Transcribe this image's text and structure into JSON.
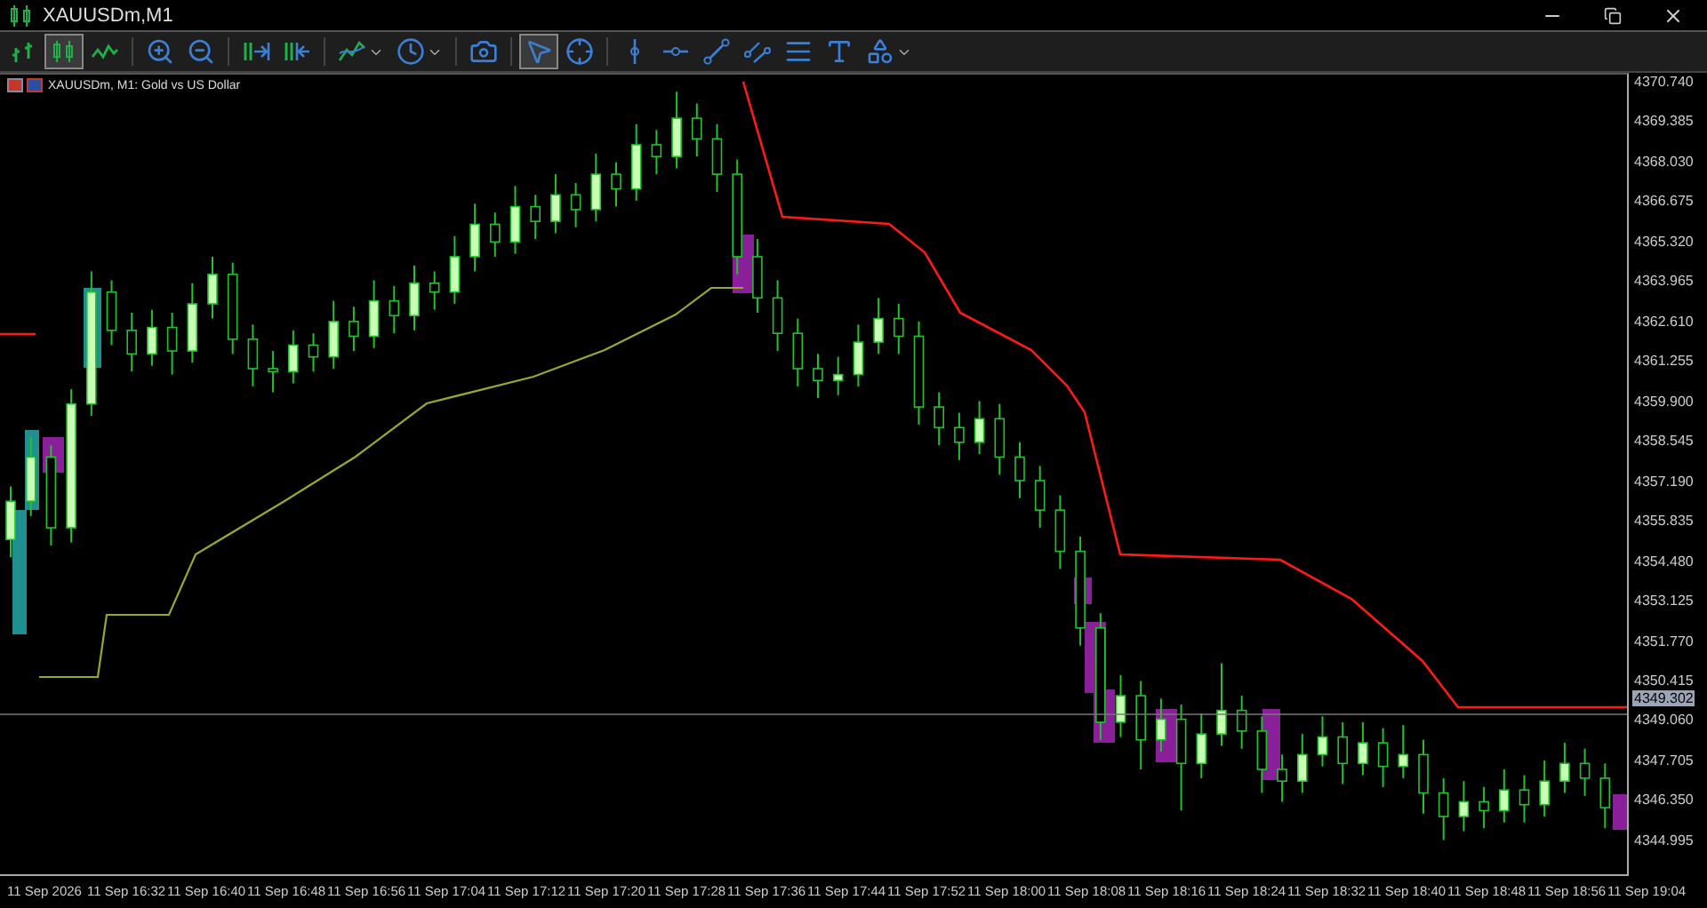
{
  "window": {
    "title": "XAUUSDm,M1"
  },
  "toolbar": [
    {
      "kind": "bars",
      "selected": false
    },
    {
      "kind": "candles",
      "selected": true
    },
    {
      "kind": "line",
      "selected": false
    },
    {
      "kind": "sep"
    },
    {
      "kind": "zoom-in",
      "selected": false
    },
    {
      "kind": "zoom-out",
      "selected": false
    },
    {
      "kind": "sep"
    },
    {
      "kind": "scroll",
      "selected": false
    },
    {
      "kind": "shift",
      "selected": false
    },
    {
      "kind": "sep"
    },
    {
      "kind": "indicators",
      "selected": false,
      "dropdown": true
    },
    {
      "kind": "clock",
      "selected": false,
      "dropdown": true
    },
    {
      "kind": "sep"
    },
    {
      "kind": "camera",
      "selected": false
    },
    {
      "kind": "sep"
    },
    {
      "kind": "cursor",
      "selected": true
    },
    {
      "kind": "crosshair",
      "selected": false
    },
    {
      "kind": "sep"
    },
    {
      "kind": "vline",
      "selected": false
    },
    {
      "kind": "hline",
      "selected": false
    },
    {
      "kind": "trend",
      "selected": false
    },
    {
      "kind": "channel",
      "selected": false
    },
    {
      "kind": "fibo",
      "selected": false
    },
    {
      "kind": "text",
      "selected": false
    },
    {
      "kind": "shapes",
      "selected": false,
      "dropdown": true
    }
  ],
  "chart": {
    "header": "XAUUSDm, M1:  Gold vs US Dollar",
    "current_price": "4349.302",
    "chart_data": {
      "type": "candlestick",
      "ylim": [
        4343.78,
        4370.98
      ],
      "yticks": [
        {
          "value": 4370.74,
          "label": "4370.740"
        },
        {
          "value": 4369.385,
          "label": "4369.385"
        },
        {
          "value": 4368.03,
          "label": "4368.030"
        },
        {
          "value": 4366.675,
          "label": "4366.675"
        },
        {
          "value": 4365.32,
          "label": "4365.320"
        },
        {
          "value": 4363.965,
          "label": "4363.965"
        },
        {
          "value": 4362.61,
          "label": "4362.610"
        },
        {
          "value": 4361.255,
          "label": "4361.255"
        },
        {
          "value": 4359.9,
          "label": "4359.900"
        },
        {
          "value": 4358.545,
          "label": "4358.545"
        },
        {
          "value": 4357.19,
          "label": "4357.190"
        },
        {
          "value": 4355.835,
          "label": "4355.835"
        },
        {
          "value": 4354.48,
          "label": "4354.480"
        },
        {
          "value": 4353.125,
          "label": "4353.125"
        },
        {
          "value": 4351.77,
          "label": "4351.770"
        },
        {
          "value": 4350.415,
          "label": "4350.415"
        },
        {
          "value": 4349.06,
          "label": "4349.060"
        },
        {
          "value": 4347.705,
          "label": "4347.705"
        },
        {
          "value": 4346.35,
          "label": "4346.350"
        },
        {
          "value": 4344.995,
          "label": "4344.995"
        }
      ],
      "categories": [
        null,
        null,
        null,
        null,
        null,
        null,
        null,
        null,
        null,
        null,
        null,
        null,
        null,
        null,
        null,
        null,
        null,
        null,
        null,
        null,
        null,
        null,
        null,
        null,
        null,
        null,
        null,
        null,
        null,
        null,
        null,
        null,
        null,
        null,
        null,
        null,
        null,
        null,
        null,
        null,
        null,
        null,
        null,
        null,
        null,
        null,
        null,
        null,
        null,
        null,
        null,
        null,
        null,
        null,
        null,
        null,
        null,
        null,
        null,
        null,
        null,
        null,
        null,
        null,
        null,
        null,
        null,
        null,
        null,
        null,
        null,
        null,
        null,
        null,
        null,
        null,
        null,
        null,
        null,
        null
      ],
      "ohlc": [
        [
          4355.2,
          4357.0,
          4354.6,
          4356.5
        ],
        [
          4356.5,
          4358.7,
          4356.0,
          4358.0
        ],
        [
          4358.0,
          4358.4,
          4355.0,
          4355.6
        ],
        [
          4355.6,
          4360.3,
          4355.1,
          4359.8
        ],
        [
          4359.8,
          4364.3,
          4359.4,
          4363.6
        ],
        [
          4363.6,
          4364.0,
          4361.8,
          4362.3
        ],
        [
          4362.3,
          4362.9,
          4360.9,
          4361.5
        ],
        [
          4361.5,
          4363.0,
          4361.1,
          4362.4
        ],
        [
          4362.4,
          4362.9,
          4360.8,
          4361.6
        ],
        [
          4361.6,
          4363.9,
          4361.2,
          4363.2
        ],
        [
          4363.2,
          4364.8,
          4362.7,
          4364.2
        ],
        [
          4364.2,
          4364.6,
          4361.5,
          4362.0
        ],
        [
          4362.0,
          4362.5,
          4360.4,
          4361.0
        ],
        [
          4361.0,
          4361.6,
          4360.2,
          4360.9
        ],
        [
          4360.9,
          4362.3,
          4360.5,
          4361.8
        ],
        [
          4361.8,
          4362.2,
          4360.9,
          4361.4
        ],
        [
          4361.4,
          4363.3,
          4361.0,
          4362.6
        ],
        [
          4362.6,
          4363.1,
          4361.6,
          4362.1
        ],
        [
          4362.1,
          4364.0,
          4361.7,
          4363.3
        ],
        [
          4363.3,
          4363.8,
          4362.2,
          4362.8
        ],
        [
          4362.8,
          4364.5,
          4362.3,
          4363.9
        ],
        [
          4363.9,
          4364.3,
          4363.0,
          4363.6
        ],
        [
          4363.6,
          4365.5,
          4363.2,
          4364.8
        ],
        [
          4364.8,
          4366.6,
          4364.3,
          4365.9
        ],
        [
          4365.9,
          4366.3,
          4364.8,
          4365.3
        ],
        [
          4365.3,
          4367.2,
          4364.9,
          4366.5
        ],
        [
          4366.5,
          4366.9,
          4365.4,
          4366.0
        ],
        [
          4366.0,
          4367.6,
          4365.6,
          4366.9
        ],
        [
          4366.9,
          4367.3,
          4365.8,
          4366.4
        ],
        [
          4366.4,
          4368.3,
          4366.0,
          4367.6
        ],
        [
          4367.6,
          4368.0,
          4366.5,
          4367.1
        ],
        [
          4367.1,
          4369.3,
          4366.7,
          4368.6
        ],
        [
          4368.6,
          4369.1,
          4367.6,
          4368.2
        ],
        [
          4368.2,
          4370.4,
          4367.8,
          4369.5
        ],
        [
          4369.5,
          4370.0,
          4368.2,
          4368.8
        ],
        [
          4368.8,
          4369.3,
          4367.0,
          4367.6
        ],
        [
          4367.6,
          4368.1,
          4364.2,
          4364.8
        ],
        [
          4364.8,
          4365.4,
          4362.9,
          4363.4
        ],
        [
          4363.4,
          4364.0,
          4361.6,
          4362.2
        ],
        [
          4362.2,
          4362.7,
          4360.4,
          4361.0
        ],
        [
          4361.0,
          4361.5,
          4360.0,
          4360.6
        ],
        [
          4360.6,
          4361.4,
          4360.1,
          4360.8
        ],
        [
          4360.8,
          4362.5,
          4360.4,
          4361.9
        ],
        [
          4361.9,
          4363.4,
          4361.5,
          4362.7
        ],
        [
          4362.7,
          4363.2,
          4361.5,
          4362.1
        ],
        [
          4362.1,
          4362.6,
          4359.1,
          4359.7
        ],
        [
          4359.7,
          4360.2,
          4358.4,
          4359.0
        ],
        [
          4359.0,
          4359.5,
          4357.9,
          4358.5
        ],
        [
          4358.5,
          4359.9,
          4358.1,
          4359.3
        ],
        [
          4359.3,
          4359.8,
          4357.4,
          4358.0
        ],
        [
          4358.0,
          4358.5,
          4356.6,
          4357.2
        ],
        [
          4357.2,
          4357.7,
          4355.6,
          4356.2
        ],
        [
          4356.2,
          4356.7,
          4354.2,
          4354.8
        ],
        [
          4354.8,
          4355.3,
          4351.6,
          4352.2
        ],
        [
          4352.2,
          4352.7,
          4348.4,
          4349.0
        ],
        [
          4349.0,
          4350.6,
          4348.5,
          4349.9
        ],
        [
          4349.9,
          4350.4,
          4347.4,
          4348.4
        ],
        [
          4348.4,
          4349.8,
          4348.0,
          4349.1
        ],
        [
          4349.1,
          4349.6,
          4346.0,
          4347.6
        ],
        [
          4347.6,
          4349.3,
          4347.1,
          4348.6
        ],
        [
          4348.6,
          4351.0,
          4348.2,
          4349.4
        ],
        [
          4349.4,
          4349.9,
          4348.1,
          4348.7
        ],
        [
          4348.7,
          4349.2,
          4346.6,
          4347.4
        ],
        [
          4347.4,
          4347.9,
          4346.3,
          4347.0
        ],
        [
          4347.0,
          4348.6,
          4346.6,
          4347.9
        ],
        [
          4347.9,
          4349.2,
          4347.5,
          4348.5
        ],
        [
          4348.5,
          4349.0,
          4346.9,
          4347.6
        ],
        [
          4347.6,
          4349.0,
          4347.2,
          4348.3
        ],
        [
          4348.3,
          4348.8,
          4346.8,
          4347.5
        ],
        [
          4347.5,
          4348.9,
          4347.1,
          4347.9
        ],
        [
          4347.9,
          4348.4,
          4345.9,
          4346.6
        ],
        [
          4346.6,
          4347.1,
          4345.0,
          4345.8
        ],
        [
          4345.8,
          4347.0,
          4345.3,
          4346.3
        ],
        [
          4346.3,
          4346.8,
          4345.4,
          4346.0
        ],
        [
          4346.0,
          4347.4,
          4345.6,
          4346.7
        ],
        [
          4346.7,
          4347.2,
          4345.6,
          4346.2
        ],
        [
          4346.2,
          4347.7,
          4345.8,
          4347.0
        ],
        [
          4347.0,
          4348.3,
          4346.6,
          4347.6
        ],
        [
          4347.6,
          4348.1,
          4346.5,
          4347.1
        ],
        [
          4347.1,
          4347.6,
          4345.4,
          4346.1
        ]
      ]
    },
    "time_labels": [
      "11 Sep 2026",
      "11 Sep 16:32",
      "11 Sep 16:40",
      "11 Sep 16:48",
      "11 Sep 16:56",
      "11 Sep 17:04",
      "11 Sep 17:12",
      "11 Sep 17:20",
      "11 Sep 17:28",
      "11 Sep 17:36",
      "11 Sep 17:44",
      "11 Sep 17:52",
      "11 Sep 18:00",
      "11 Sep 18:08",
      "11 Sep 18:16",
      "11 Sep 18:24",
      "11 Sep 18:32",
      "11 Sep 18:40",
      "11 Sep 18:48",
      "11 Sep 18:56",
      "11 Sep 19:04"
    ]
  }
}
